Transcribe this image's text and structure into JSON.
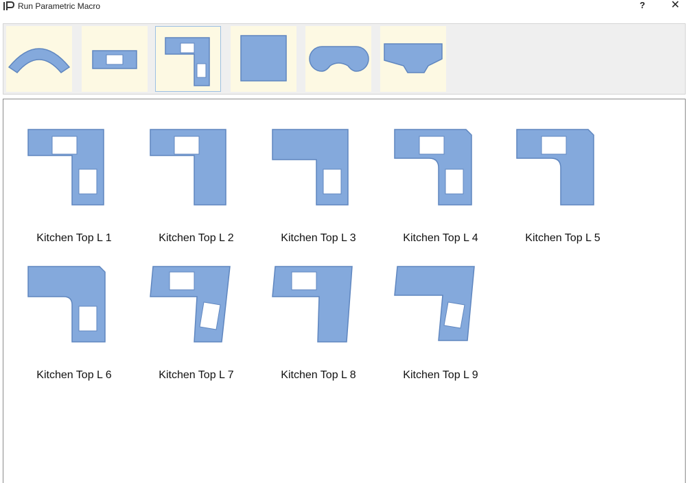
{
  "window": {
    "title": "Run Parametric Macro",
    "help_label": "?",
    "close_label": "✕"
  },
  "colors": {
    "shape_fill": "#84a9dc",
    "shape_stroke": "#5f86bf",
    "tile_bg": "#fdf9e3"
  },
  "toolbar": {
    "tools": [
      {
        "name": "arc-countertop-icon"
      },
      {
        "name": "rect-sink-countertop-icon"
      },
      {
        "name": "l-shape-countertop-icon",
        "selected": true
      },
      {
        "name": "square-countertop-icon"
      },
      {
        "name": "rounded-notch-countertop-icon"
      },
      {
        "name": "trapezoid-countertop-icon"
      }
    ]
  },
  "items": [
    {
      "label": "Kitchen Top L 1"
    },
    {
      "label": "Kitchen Top L 2"
    },
    {
      "label": "Kitchen Top L 3"
    },
    {
      "label": "Kitchen Top L 4"
    },
    {
      "label": "Kitchen Top L 5"
    },
    {
      "label": "Kitchen Top L 6"
    },
    {
      "label": "Kitchen Top L 7"
    },
    {
      "label": "Kitchen Top L 8"
    },
    {
      "label": "Kitchen Top L 9"
    }
  ]
}
